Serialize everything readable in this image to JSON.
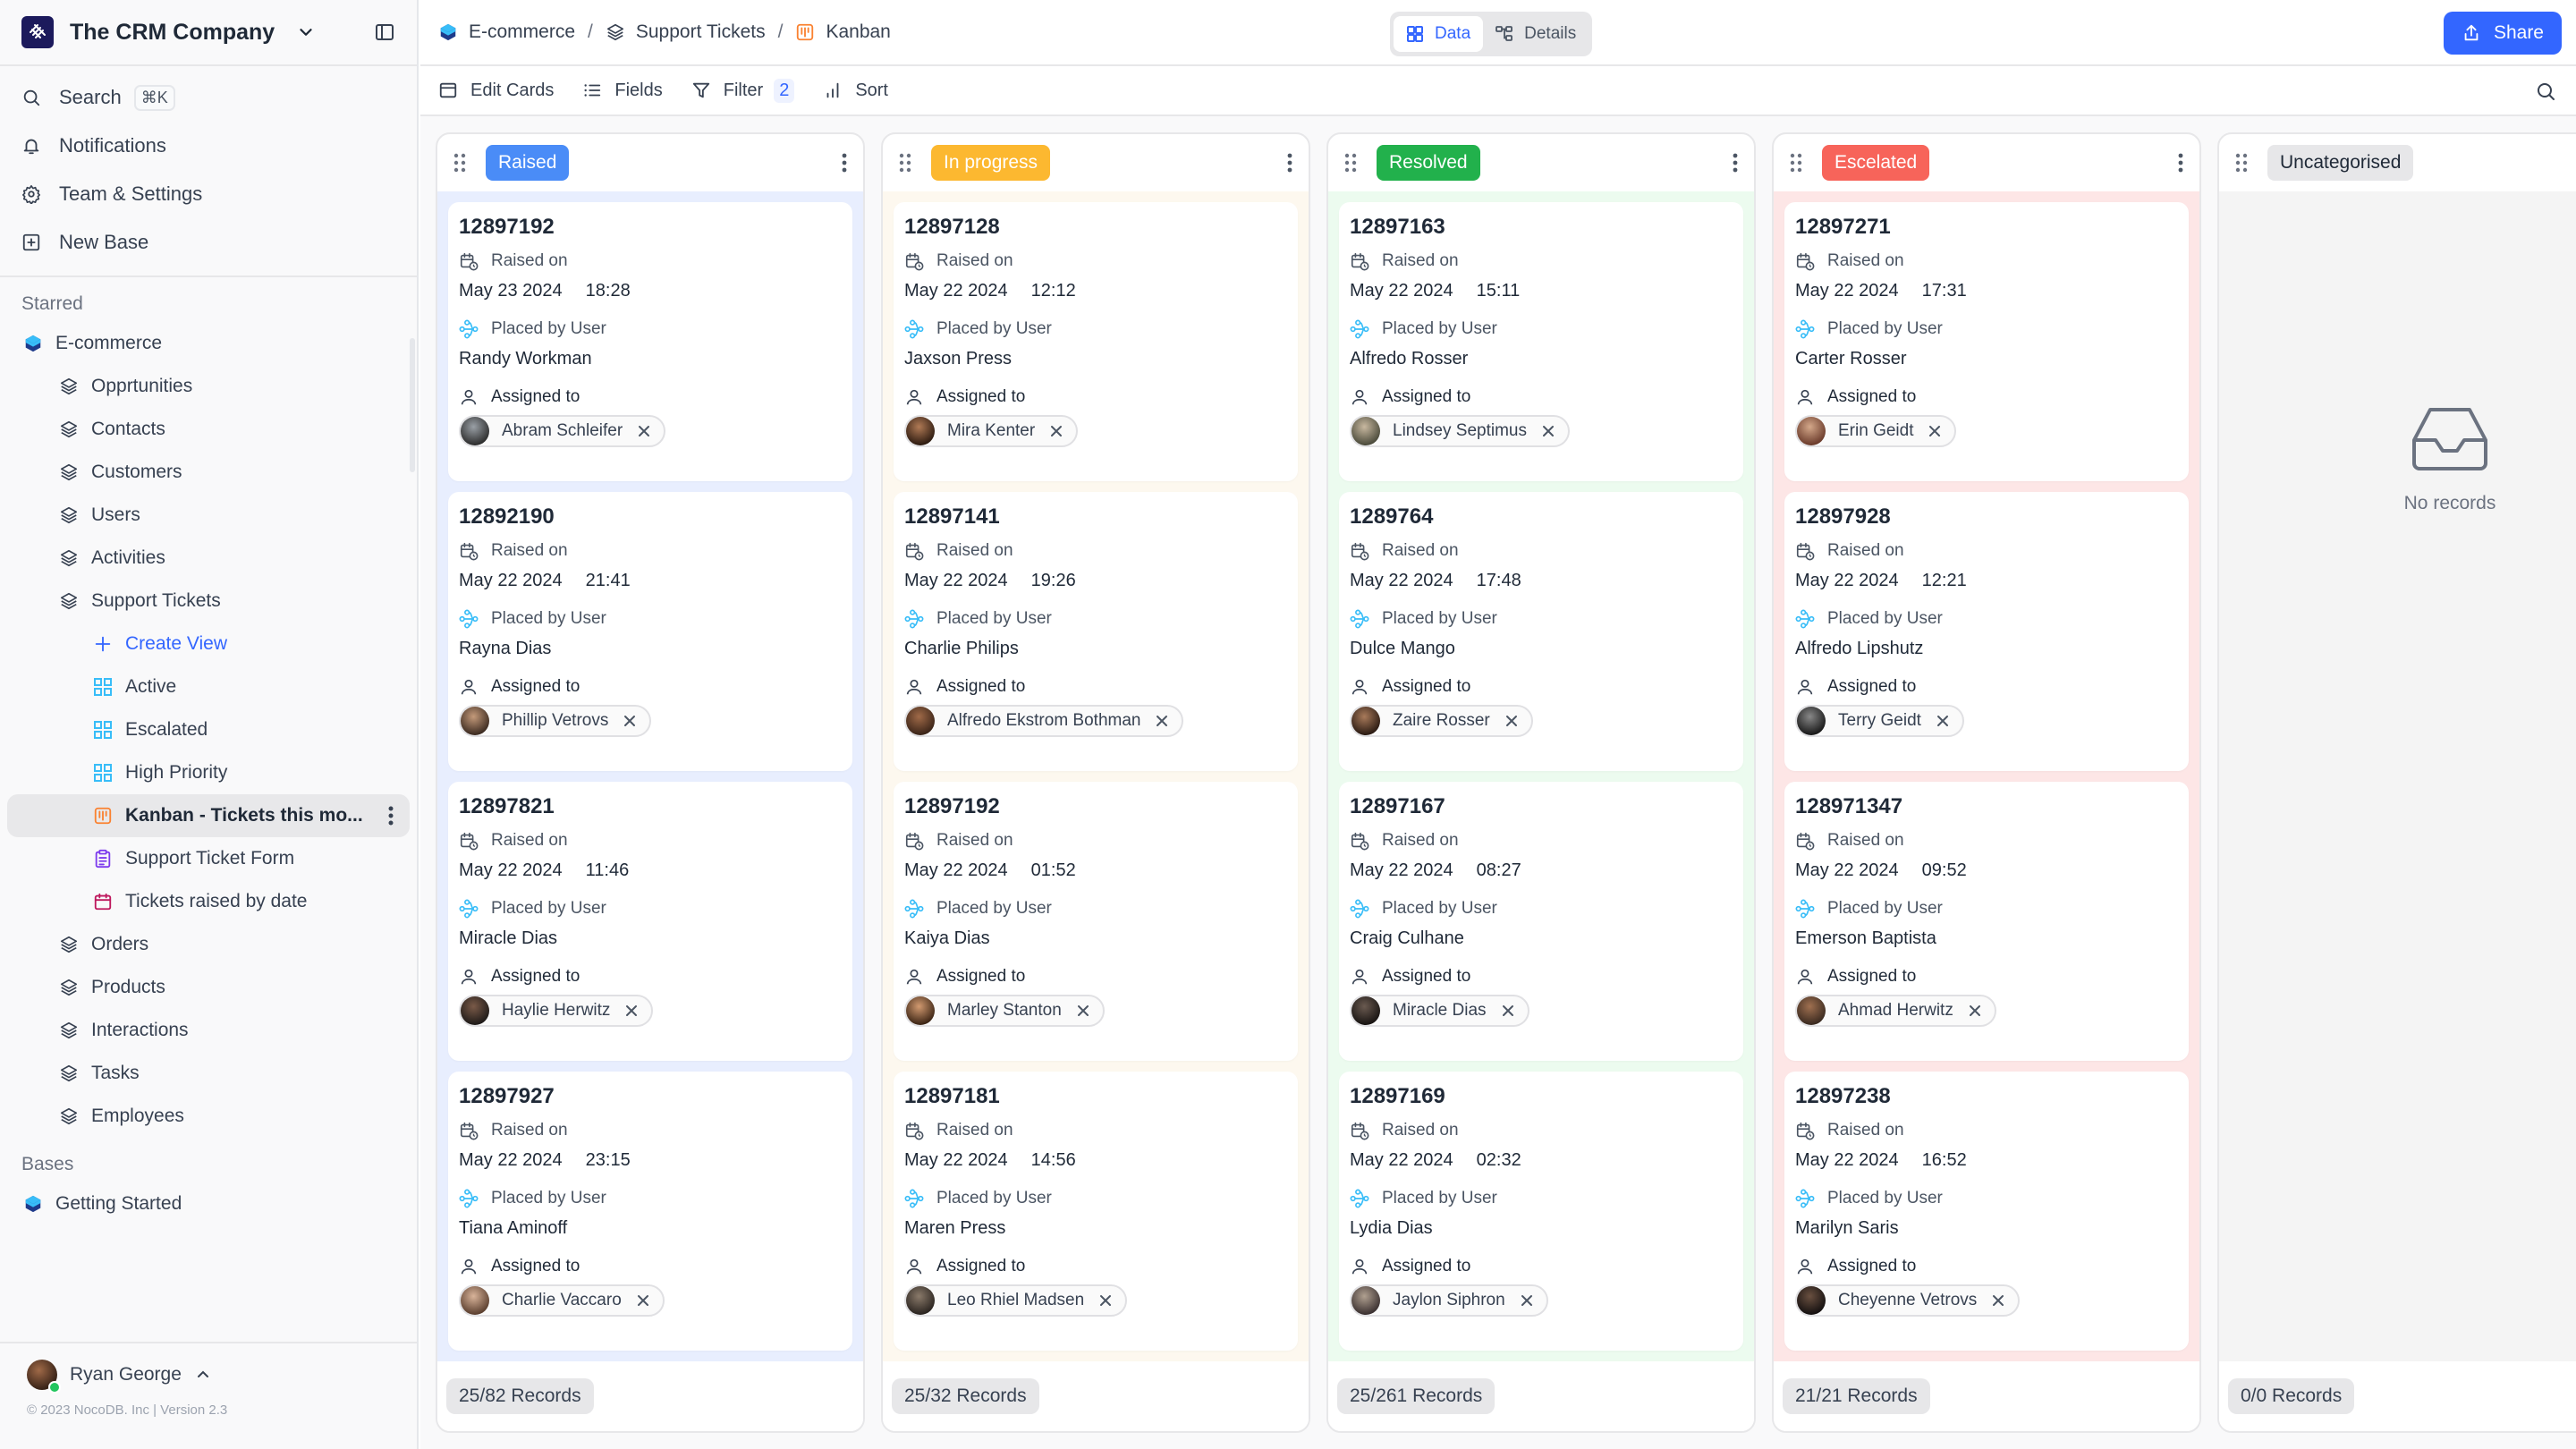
{
  "workspace": {
    "name": "The CRM Company"
  },
  "nav": {
    "search": "Search",
    "search_shortcut": "⌘K",
    "notifications": "Notifications",
    "team_settings": "Team & Settings",
    "new_base": "New Base"
  },
  "sidebar": {
    "starred_label": "Starred",
    "bases_label": "Bases",
    "starred_base": "E-commerce",
    "tables_top": [
      "Opprtunities",
      "Contacts",
      "Customers",
      "Users",
      "Activities",
      "Support Tickets"
    ],
    "views": {
      "create": "Create View",
      "grid_views": [
        "Active",
        "Escalated",
        "High Priority"
      ],
      "kanban_active": "Kanban - Tickets this mo...",
      "form": "Support Ticket Form",
      "calendar": "Tickets raised by date"
    },
    "tables_bottom": [
      "Orders",
      "Products",
      "Interactions",
      "Tasks",
      "Employees"
    ],
    "bases": [
      "Getting Started"
    ],
    "user": "Ryan George",
    "copyright": "© 2023 NocoDB. Inc | Version 2.3"
  },
  "breadcrumb": [
    "E-commerce",
    "Support Tickets",
    "Kanban"
  ],
  "view_toggle": {
    "data": "Data",
    "details": "Details"
  },
  "share_label": "Share",
  "toolbar": {
    "edit_cards": "Edit Cards",
    "fields": "Fields",
    "filter": "Filter",
    "filter_count": "2",
    "sort": "Sort"
  },
  "colors": {
    "accent": "#3366ff",
    "raised": "#4a8cf7",
    "in_progress": "#fcb830",
    "resolved": "#22b14c",
    "escalated": "#f7645a",
    "uncategorised": "#e7e7e9"
  },
  "card_labels": {
    "raised_on": "Raised on",
    "placed_by": "Placed by User",
    "assigned_to": "Assigned to"
  },
  "columns": [
    {
      "title": "Raised",
      "records": "25/82 Records",
      "cards": [
        {
          "id": "12897192",
          "date": "May 23 2024",
          "time": "18:28",
          "placed_by": "Randy Workman",
          "assignee": "Abram Schleifer"
        },
        {
          "id": "12892190",
          "date": "May 22 2024",
          "time": "21:41",
          "placed_by": "Rayna Dias",
          "assignee": "Phillip Vetrovs"
        },
        {
          "id": "12897821",
          "date": "May 22 2024",
          "time": "11:46",
          "placed_by": "Miracle Dias",
          "assignee": "Haylie Herwitz"
        },
        {
          "id": "12897927",
          "date": "May 22 2024",
          "time": "23:15",
          "placed_by": "Tiana Aminoff",
          "assignee": "Charlie Vaccaro"
        }
      ]
    },
    {
      "title": "In progress",
      "records": "25/32 Records",
      "cards": [
        {
          "id": "12897128",
          "date": "May 22 2024",
          "time": "12:12",
          "placed_by": "Jaxson Press",
          "assignee": "Mira Kenter"
        },
        {
          "id": "12897141",
          "date": "May 22 2024",
          "time": "19:26",
          "placed_by": "Charlie Philips",
          "assignee": "Alfredo Ekstrom Bothman"
        },
        {
          "id": "12897192",
          "date": "May 22 2024",
          "time": "01:52",
          "placed_by": "Kaiya Dias",
          "assignee": "Marley Stanton"
        },
        {
          "id": "12897181",
          "date": "May 22 2024",
          "time": "14:56",
          "placed_by": "Maren Press",
          "assignee": "Leo Rhiel Madsen"
        }
      ]
    },
    {
      "title": "Resolved",
      "records": "25/261 Records",
      "cards": [
        {
          "id": "12897163",
          "date": "May 22 2024",
          "time": "15:11",
          "placed_by": "Alfredo Rosser",
          "assignee": "Lindsey Septimus"
        },
        {
          "id": "1289764",
          "date": "May 22 2024",
          "time": "17:48",
          "placed_by": "Dulce Mango",
          "assignee": "Zaire Rosser"
        },
        {
          "id": "12897167",
          "date": "May 22 2024",
          "time": "08:27",
          "placed_by": "Craig Culhane",
          "assignee": "Miracle Dias"
        },
        {
          "id": "12897169",
          "date": "May 22 2024",
          "time": "02:32",
          "placed_by": "Lydia Dias",
          "assignee": "Jaylon Siphron"
        }
      ]
    },
    {
      "title": "Escelated",
      "records": "21/21 Records",
      "cards": [
        {
          "id": "12897271",
          "date": "May 22 2024",
          "time": "17:31",
          "placed_by": "Carter Rosser",
          "assignee": "Erin Geidt"
        },
        {
          "id": "12897928",
          "date": "May 22 2024",
          "time": "12:21",
          "placed_by": "Alfredo Lipshutz",
          "assignee": "Terry Geidt"
        },
        {
          "id": "128971347",
          "date": "May 22 2024",
          "time": "09:52",
          "placed_by": "Emerson Baptista",
          "assignee": "Ahmad Herwitz"
        },
        {
          "id": "12897238",
          "date": "May 22 2024",
          "time": "16:52",
          "placed_by": "Marilyn Saris",
          "assignee": "Cheyenne Vetrovs"
        }
      ]
    },
    {
      "title": "Uncategorised",
      "records": "0/0 Records",
      "empty_text": "No records",
      "cards": []
    }
  ]
}
